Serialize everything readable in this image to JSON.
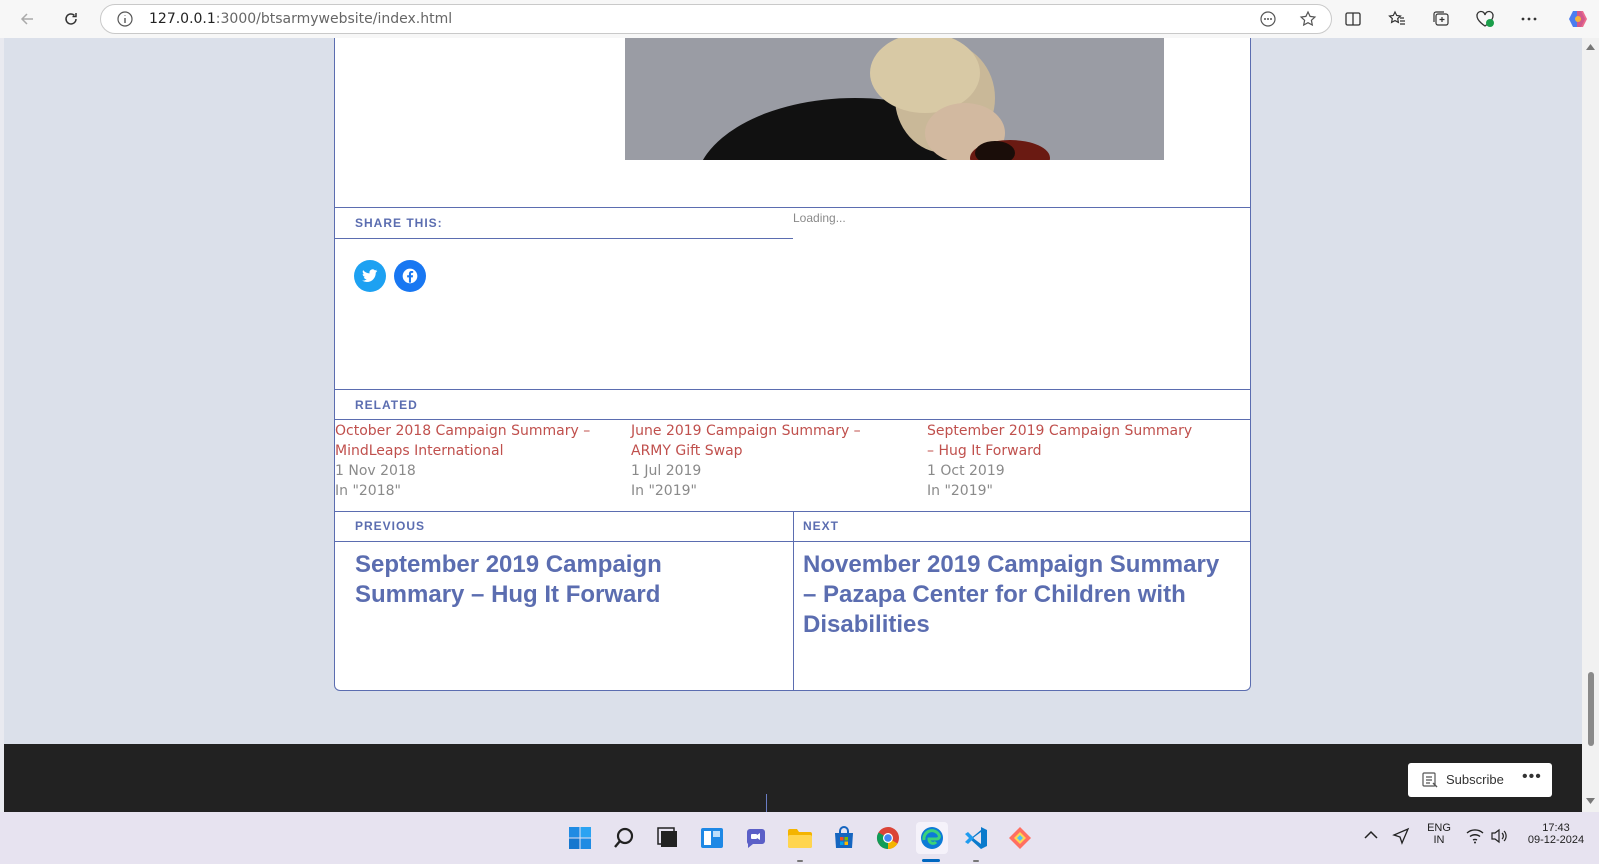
{
  "browser": {
    "url_host": "127.0.0.1",
    "url_rest": ":3000/btsarmywebsite/index.html"
  },
  "post": {
    "share_title": "SHARE THIS:",
    "loading_text": "Loading...",
    "related_title": "RELATED",
    "related": [
      {
        "title": "October 2018 Campaign Summary – MindLeaps International",
        "date": "1 Nov 2018",
        "category": "In \"2018\""
      },
      {
        "title": "June 2019 Campaign Summary – ARMY Gift Swap",
        "date": "1 Jul 2019",
        "category": "In \"2019\""
      },
      {
        "title": "September 2019 Campaign Summary – Hug It Forward",
        "date": "1 Oct 2019",
        "category": "In \"2019\""
      }
    ],
    "previous_label": "PREVIOUS",
    "previous_title": "September 2019 Campaign Summary – Hug It Forward",
    "next_label": "NEXT",
    "next_title": "November 2019 Campaign Summary – Pazapa Center for Children with Disabilities"
  },
  "footer": {
    "subscribe_label": "Subscribe",
    "more_label": "•••"
  },
  "taskbar": {
    "lang_primary": "ENG",
    "lang_secondary": "IN",
    "time": "17:43",
    "date": "09-12-2024"
  },
  "colors": {
    "accent": "#5b6db0",
    "link": "#c0504d",
    "twitter": "#1da1f2",
    "facebook": "#1877f2",
    "footer": "#222222"
  },
  "icons": [
    "back-icon",
    "refresh-icon",
    "info-icon",
    "reader-icon",
    "favorite-icon",
    "split-screen-icon",
    "favorites-icon",
    "collections-icon",
    "health-icon",
    "more-icon",
    "copilot-icon",
    "twitter-icon",
    "facebook-icon",
    "subscribe-icon"
  ]
}
